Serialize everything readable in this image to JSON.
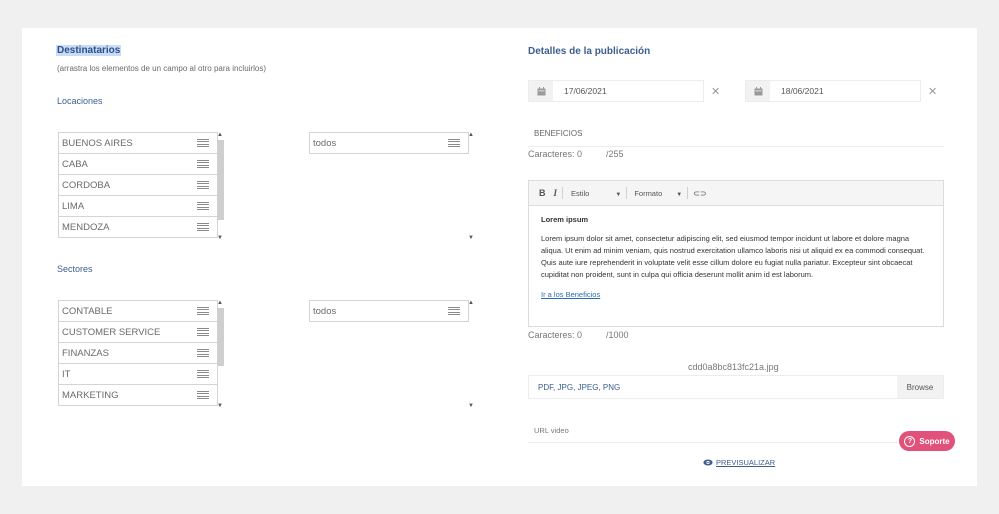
{
  "recipients": {
    "title": "Destinatarios",
    "subtitle": "(arrastra los elementos de un campo al otro para incluirlos)"
  },
  "locations": {
    "label": "Locaciones",
    "available": [
      "BUENOS AIRES",
      "CABA",
      "CORDOBA",
      "LIMA",
      "MENDOZA"
    ],
    "selected": [
      "todos"
    ]
  },
  "sectors": {
    "label": "Sectores",
    "available": [
      "CONTABLE",
      "CUSTOMER SERVICE",
      "FINANZAS",
      "IT",
      "MARKETING"
    ],
    "selected": [
      "todos"
    ]
  },
  "publication": {
    "title": "Detalles de la publicación",
    "date_start": "17/06/2021",
    "date_end": "18/06/2021",
    "benefits_placeholder": "BENEFICIOS",
    "chars_title_label": "Caracteres: 0",
    "chars_title_max": "/255",
    "chars_body_label": "Caracteres: 0",
    "chars_body_max": "/1000"
  },
  "editor": {
    "bold": "B",
    "italic": "I",
    "style_label": "Estilo",
    "format_label": "Formato",
    "heading": "Lorem ipsum",
    "body": "Lorem ipsum dolor sit amet, consectetur adipiscing elit, sed eiusmod tempor incidunt ut labore et dolore magna aliqua. Ut enim ad minim veniam, quis nostrud exercitation ullamco laboris nisi ut aliquid ex ea commodi consequat. Quis aute iure reprehenderit in voluptate velit esse cillum dolore eu fugiat nulla pariatur. Excepteur sint obcaecat cupiditat non proident, sunt in culpa qui officia deserunt mollit anim id est laborum.",
    "link": "Ir a los Beneficios"
  },
  "upload": {
    "filename": "cdd0a8bc813fc21a.jpg",
    "accepted": "PDF, JPG, JPEG, PNG",
    "browse": "Browse"
  },
  "video": {
    "placeholder": "URL video"
  },
  "preview": {
    "label": "PREVISUALIZAR"
  },
  "support": {
    "label": "Soporte"
  },
  "colors": {
    "accent": "#2a4f8a",
    "support": "#e0527a",
    "link": "#2a6db0"
  }
}
